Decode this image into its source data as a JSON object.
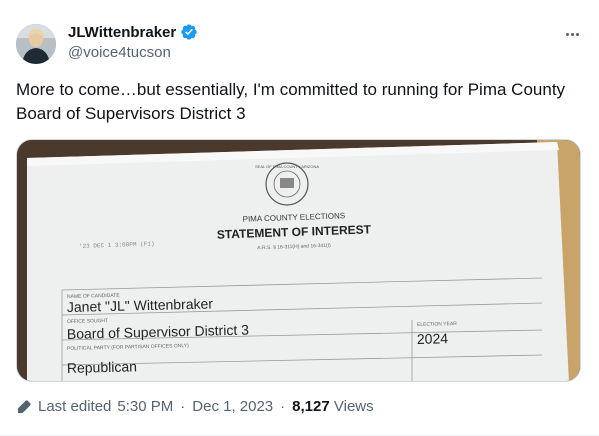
{
  "author": {
    "display_name": "JLWittenbraker",
    "handle": "@voice4tucson",
    "verified": true
  },
  "tweet": {
    "text": "More to come…but essentially, I'm committed to running for Pima County Board of Supervisors District 3"
  },
  "media": {
    "seal_text": "SEAL OF PIMA COUNTY ARIZONA",
    "header_small": "PIMA COUNTY ELECTIONS",
    "header_title": "STATEMENT OF INTEREST",
    "statute": "A.R.S. § 16-311(H) and 16-341(I)",
    "stamp": "'23 DEC 1 3:00PM (F1)",
    "fields": {
      "name_label": "NAME OF CANDIDATE",
      "name_value": "Janet \"JL\" Wittenbraker",
      "office_label": "OFFICE SOUGHT",
      "office_value": "Board of Supervisor District 3",
      "year_label": "ELECTION YEAR",
      "year_value": "2024",
      "party_label": "POLITICAL PARTY (FOR PARTISAN OFFICES ONLY)",
      "party_value": "Republican"
    }
  },
  "meta": {
    "edited_label": "Last edited",
    "time": "5:30 PM",
    "date": "Dec 1, 2023",
    "views_count": "8,127",
    "views_label": "Views"
  },
  "colors": {
    "verified_blue": "#1d9bf0",
    "secondary_text": "#536471",
    "primary_text": "#0f1419"
  },
  "icons": [
    "verified-badge-icon",
    "more-options-icon",
    "pencil-edit-icon"
  ]
}
